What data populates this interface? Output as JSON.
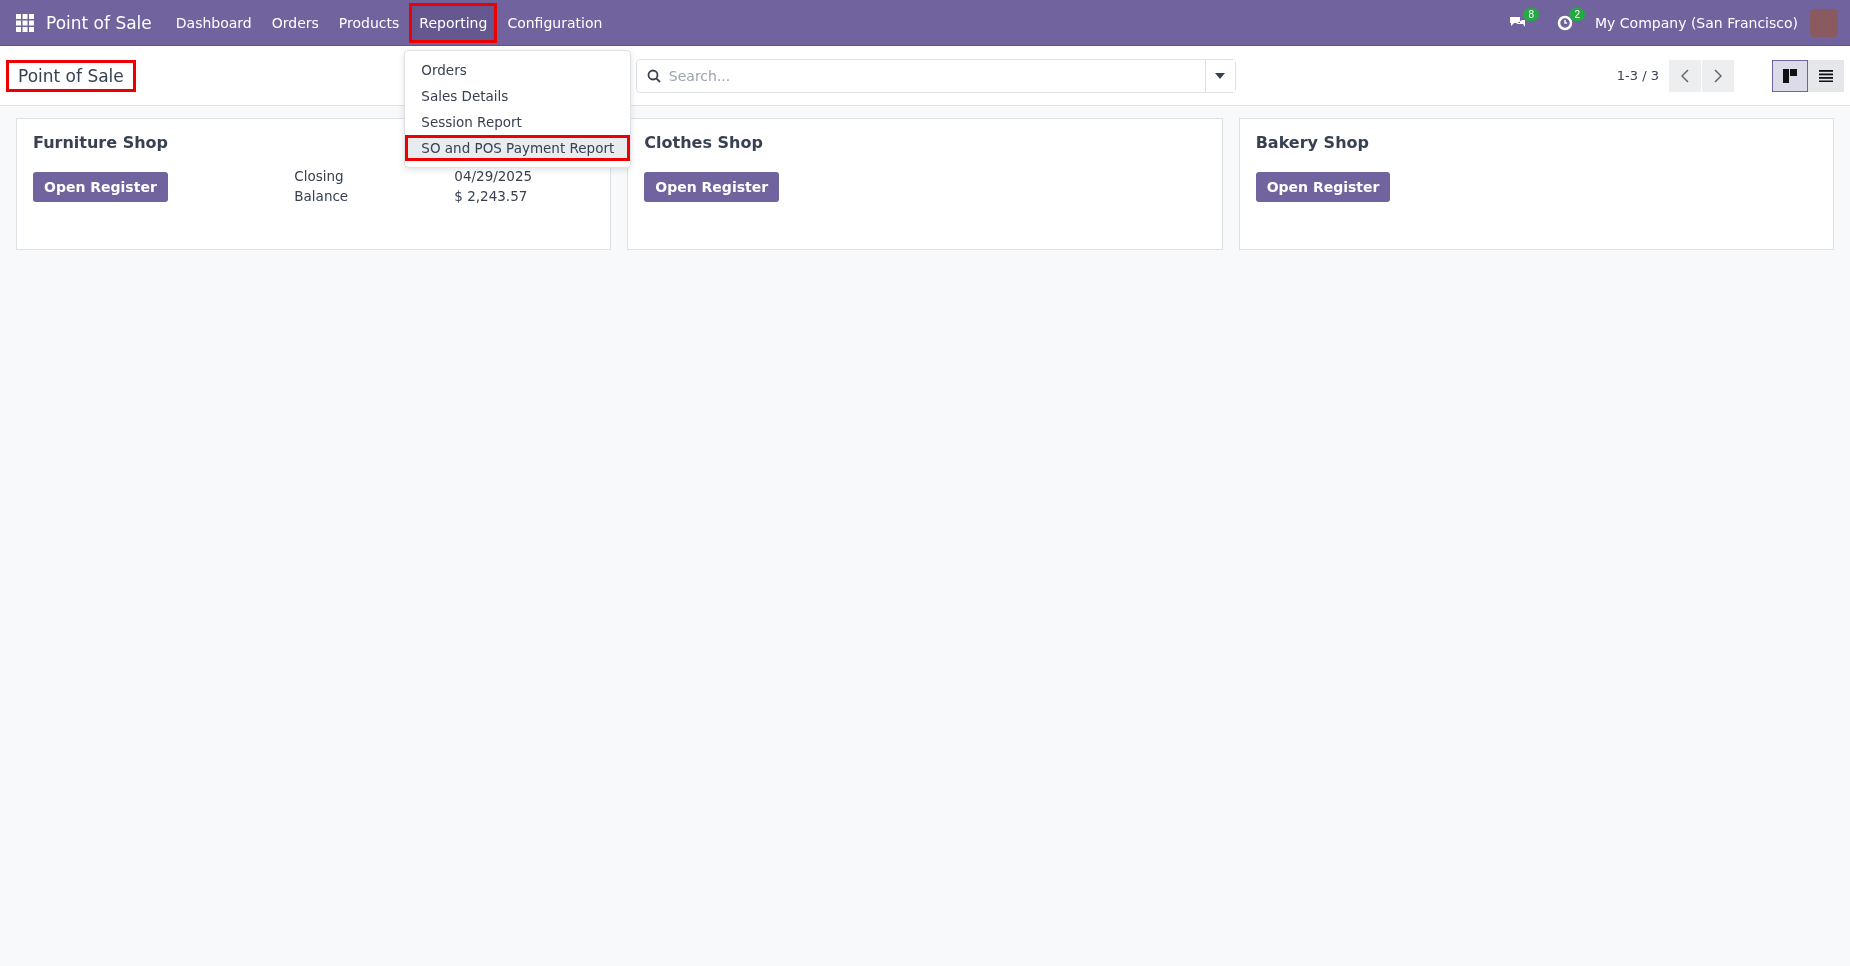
{
  "navbar": {
    "app_name": "Point of Sale",
    "menu": [
      {
        "label": "Dashboard",
        "selected": false,
        "highlighted": false
      },
      {
        "label": "Orders",
        "selected": false,
        "highlighted": false
      },
      {
        "label": "Products",
        "selected": false,
        "highlighted": false
      },
      {
        "label": "Reporting",
        "selected": true,
        "highlighted": true
      },
      {
        "label": "Configuration",
        "selected": false,
        "highlighted": false
      }
    ],
    "messages_badge": "8",
    "activities_badge": "2",
    "company": "My Company (San Francisco)"
  },
  "dropdown": {
    "items": [
      {
        "label": "Orders",
        "selected": false,
        "highlighted": false
      },
      {
        "label": "Sales Details",
        "selected": false,
        "highlighted": false
      },
      {
        "label": "Session Report",
        "selected": false,
        "highlighted": false
      },
      {
        "label": "SO and POS Payment Report",
        "selected": true,
        "highlighted": true
      }
    ]
  },
  "control_panel": {
    "breadcrumb": "Point of Sale",
    "breadcrumb_highlighted": true,
    "search": {
      "placeholder": "Search..."
    },
    "pager": "1-3 / 3",
    "views": [
      {
        "kind": "kanban",
        "selected": true
      },
      {
        "kind": "list",
        "selected": false
      }
    ]
  },
  "cards": [
    {
      "title": "Furniture Shop",
      "button": "Open Register",
      "details": [
        {
          "label": "Closing",
          "value": "04/29/2025"
        },
        {
          "label": "Balance",
          "value": "$ 2,243.57"
        }
      ]
    },
    {
      "title": "Clothes Shop",
      "button": "Open Register"
    },
    {
      "title": "Bakery Shop",
      "button": "Open Register"
    }
  ]
}
